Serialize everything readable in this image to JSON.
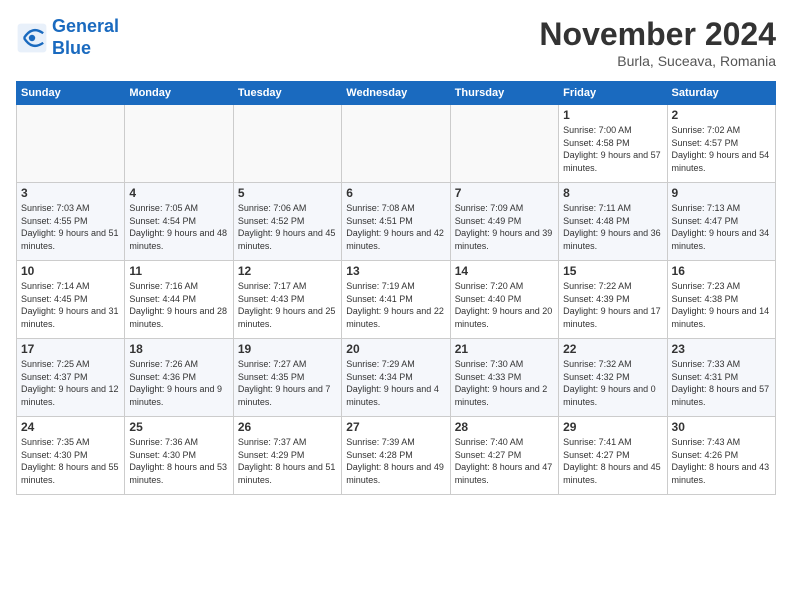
{
  "logo": {
    "line1": "General",
    "line2": "Blue"
  },
  "title": "November 2024",
  "location": "Burla, Suceava, Romania",
  "days_header": [
    "Sunday",
    "Monday",
    "Tuesday",
    "Wednesday",
    "Thursday",
    "Friday",
    "Saturday"
  ],
  "weeks": [
    [
      {
        "num": "",
        "info": ""
      },
      {
        "num": "",
        "info": ""
      },
      {
        "num": "",
        "info": ""
      },
      {
        "num": "",
        "info": ""
      },
      {
        "num": "",
        "info": ""
      },
      {
        "num": "1",
        "info": "Sunrise: 7:00 AM\nSunset: 4:58 PM\nDaylight: 9 hours and 57 minutes."
      },
      {
        "num": "2",
        "info": "Sunrise: 7:02 AM\nSunset: 4:57 PM\nDaylight: 9 hours and 54 minutes."
      }
    ],
    [
      {
        "num": "3",
        "info": "Sunrise: 7:03 AM\nSunset: 4:55 PM\nDaylight: 9 hours and 51 minutes."
      },
      {
        "num": "4",
        "info": "Sunrise: 7:05 AM\nSunset: 4:54 PM\nDaylight: 9 hours and 48 minutes."
      },
      {
        "num": "5",
        "info": "Sunrise: 7:06 AM\nSunset: 4:52 PM\nDaylight: 9 hours and 45 minutes."
      },
      {
        "num": "6",
        "info": "Sunrise: 7:08 AM\nSunset: 4:51 PM\nDaylight: 9 hours and 42 minutes."
      },
      {
        "num": "7",
        "info": "Sunrise: 7:09 AM\nSunset: 4:49 PM\nDaylight: 9 hours and 39 minutes."
      },
      {
        "num": "8",
        "info": "Sunrise: 7:11 AM\nSunset: 4:48 PM\nDaylight: 9 hours and 36 minutes."
      },
      {
        "num": "9",
        "info": "Sunrise: 7:13 AM\nSunset: 4:47 PM\nDaylight: 9 hours and 34 minutes."
      }
    ],
    [
      {
        "num": "10",
        "info": "Sunrise: 7:14 AM\nSunset: 4:45 PM\nDaylight: 9 hours and 31 minutes."
      },
      {
        "num": "11",
        "info": "Sunrise: 7:16 AM\nSunset: 4:44 PM\nDaylight: 9 hours and 28 minutes."
      },
      {
        "num": "12",
        "info": "Sunrise: 7:17 AM\nSunset: 4:43 PM\nDaylight: 9 hours and 25 minutes."
      },
      {
        "num": "13",
        "info": "Sunrise: 7:19 AM\nSunset: 4:41 PM\nDaylight: 9 hours and 22 minutes."
      },
      {
        "num": "14",
        "info": "Sunrise: 7:20 AM\nSunset: 4:40 PM\nDaylight: 9 hours and 20 minutes."
      },
      {
        "num": "15",
        "info": "Sunrise: 7:22 AM\nSunset: 4:39 PM\nDaylight: 9 hours and 17 minutes."
      },
      {
        "num": "16",
        "info": "Sunrise: 7:23 AM\nSunset: 4:38 PM\nDaylight: 9 hours and 14 minutes."
      }
    ],
    [
      {
        "num": "17",
        "info": "Sunrise: 7:25 AM\nSunset: 4:37 PM\nDaylight: 9 hours and 12 minutes."
      },
      {
        "num": "18",
        "info": "Sunrise: 7:26 AM\nSunset: 4:36 PM\nDaylight: 9 hours and 9 minutes."
      },
      {
        "num": "19",
        "info": "Sunrise: 7:27 AM\nSunset: 4:35 PM\nDaylight: 9 hours and 7 minutes."
      },
      {
        "num": "20",
        "info": "Sunrise: 7:29 AM\nSunset: 4:34 PM\nDaylight: 9 hours and 4 minutes."
      },
      {
        "num": "21",
        "info": "Sunrise: 7:30 AM\nSunset: 4:33 PM\nDaylight: 9 hours and 2 minutes."
      },
      {
        "num": "22",
        "info": "Sunrise: 7:32 AM\nSunset: 4:32 PM\nDaylight: 9 hours and 0 minutes."
      },
      {
        "num": "23",
        "info": "Sunrise: 7:33 AM\nSunset: 4:31 PM\nDaylight: 8 hours and 57 minutes."
      }
    ],
    [
      {
        "num": "24",
        "info": "Sunrise: 7:35 AM\nSunset: 4:30 PM\nDaylight: 8 hours and 55 minutes."
      },
      {
        "num": "25",
        "info": "Sunrise: 7:36 AM\nSunset: 4:30 PM\nDaylight: 8 hours and 53 minutes."
      },
      {
        "num": "26",
        "info": "Sunrise: 7:37 AM\nSunset: 4:29 PM\nDaylight: 8 hours and 51 minutes."
      },
      {
        "num": "27",
        "info": "Sunrise: 7:39 AM\nSunset: 4:28 PM\nDaylight: 8 hours and 49 minutes."
      },
      {
        "num": "28",
        "info": "Sunrise: 7:40 AM\nSunset: 4:27 PM\nDaylight: 8 hours and 47 minutes."
      },
      {
        "num": "29",
        "info": "Sunrise: 7:41 AM\nSunset: 4:27 PM\nDaylight: 8 hours and 45 minutes."
      },
      {
        "num": "30",
        "info": "Sunrise: 7:43 AM\nSunset: 4:26 PM\nDaylight: 8 hours and 43 minutes."
      }
    ]
  ]
}
